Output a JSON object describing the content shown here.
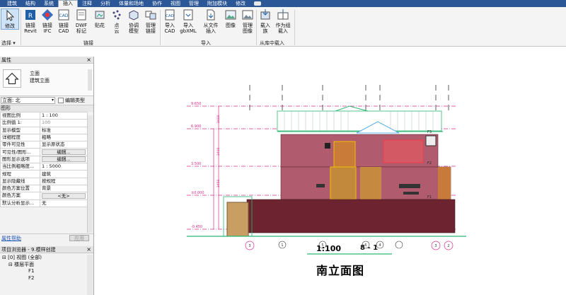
{
  "ribbon_tabs": [
    "建筑",
    "结构",
    "系统",
    "插入",
    "注释",
    "分析",
    "体量和场地",
    "协作",
    "视图",
    "管理",
    "附加模块",
    "修改"
  ],
  "active_tab": "插入",
  "ribbon": {
    "modify": "修改",
    "select_group": "选择",
    "link_revit": "链接\nRevit",
    "link_ifc": "链接\nIFC",
    "link_cad": "链接\nCAD",
    "dwf_markup": "DWF\n标记",
    "decal": "贴花",
    "point_cloud": "点\n云",
    "coordination_model": "协调\n模型",
    "manage_links": "管理\n链接",
    "link_group": "链接",
    "import_cad": "导入\nCAD",
    "import_gbxml": "导入\ngbXML",
    "insert_from_file": "从文件\n插入",
    "image": "图像",
    "manage_images": "管理\n图像",
    "import_group": "导入",
    "load_family": "载入\n族",
    "load_as_group": "作为组\n载入",
    "library_group": "从库中载入"
  },
  "properties": {
    "panel_title": "属性",
    "type_name": "立面",
    "type_sub": "建筑立面",
    "view_selector": "立面: 北",
    "edit_type": "编辑类型",
    "section": "图形",
    "rows": [
      {
        "k": "视图比例",
        "v": "1 : 100"
      },
      {
        "k": "比例值 1:",
        "v": "100"
      },
      {
        "k": "显示模型",
        "v": "标准"
      },
      {
        "k": "详细程度",
        "v": "粗略"
      },
      {
        "k": "零件可见性",
        "v": "显示原状态"
      },
      {
        "k": "可见性/图形...",
        "v": "编辑..."
      },
      {
        "k": "图形显示选项",
        "v": "编辑..."
      },
      {
        "k": "当比例粗略度...",
        "v": "1 : 5000"
      },
      {
        "k": "规程",
        "v": "建筑"
      },
      {
        "k": "显示隐藏线",
        "v": "按规程"
      },
      {
        "k": "颜色方案位置",
        "v": "背景"
      },
      {
        "k": "颜色方案",
        "v": "<无>"
      },
      {
        "k": "默认分析显示...",
        "v": "无"
      }
    ],
    "help_link": "属性帮助",
    "apply": "应用"
  },
  "project_browser": {
    "title": "项目浏览器 - 9.模样创建",
    "items": [
      "[0] 视图 (全部)",
      "楼层平面",
      "F1",
      "F2"
    ]
  },
  "canvas": {
    "scale": "1:100",
    "view_tag": "8 - 1",
    "title": "南立面图",
    "level_values": [
      "9.650",
      "6.900",
      "3.500",
      "±0.000",
      "-0.450"
    ],
    "level_names": [
      "F3",
      "F2",
      "F1"
    ],
    "height_dims": [
      "3400",
      "3400",
      "3450"
    ],
    "grid_marks": [
      "3",
      "1",
      "5",
      "6",
      "4",
      "3",
      "2"
    ]
  }
}
